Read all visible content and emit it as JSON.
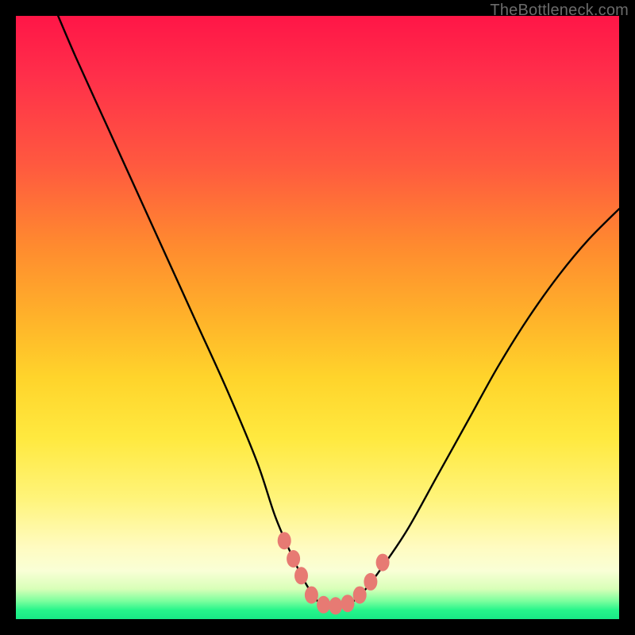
{
  "watermark": "TheBottleneck.com",
  "colors": {
    "frame": "#000000",
    "curve": "#000000",
    "marker": "#e77a73",
    "gradient_top": "#ff1647",
    "gradient_bottom": "#18e986"
  },
  "chart_data": {
    "type": "line",
    "title": "",
    "xlabel": "",
    "ylabel": "",
    "xlim": [
      0,
      100
    ],
    "ylim": [
      0,
      100
    ],
    "series": [
      {
        "name": "bottleneck-curve",
        "x": [
          7,
          10,
          15,
          20,
          25,
          30,
          35,
          40,
          43,
          46,
          48,
          50,
          52,
          54,
          56,
          58,
          61,
          65,
          70,
          75,
          80,
          85,
          90,
          95,
          100
        ],
        "y": [
          100,
          93,
          82,
          71,
          60,
          49,
          38,
          26,
          17,
          10,
          6,
          3,
          2,
          2,
          3,
          5,
          9,
          15,
          24,
          33,
          42,
          50,
          57,
          63,
          68
        ]
      }
    ],
    "markers": {
      "name": "highlight-dots",
      "x": [
        44.5,
        46.0,
        47.3,
        49.0,
        51.0,
        53.0,
        55.0,
        57.0,
        58.8,
        60.8
      ],
      "y": [
        13.0,
        10.0,
        7.2,
        4.0,
        2.4,
        2.2,
        2.6,
        4.0,
        6.2,
        9.4
      ]
    }
  }
}
